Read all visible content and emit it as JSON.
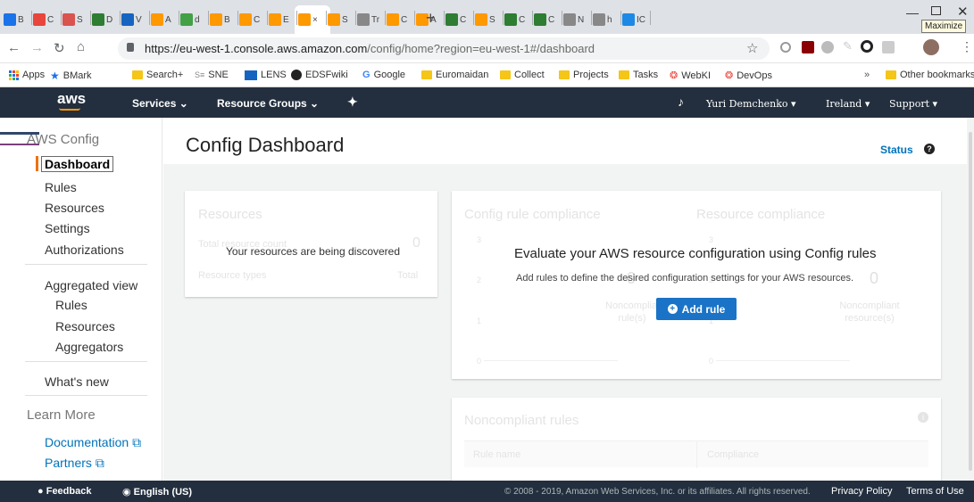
{
  "browser": {
    "tabs": [
      {
        "label": "B",
        "color": "#1a73e8"
      },
      {
        "label": "C",
        "color": "#e8453c"
      },
      {
        "label": "S",
        "color": "#d9534f"
      },
      {
        "label": "D",
        "color": "#2e7d32"
      },
      {
        "label": "V",
        "color": "#1565c0"
      },
      {
        "label": "A",
        "color": "#ff9900"
      },
      {
        "label": "d",
        "color": "#43a047"
      },
      {
        "label": "B",
        "color": "#ff9900"
      },
      {
        "label": "C",
        "color": "#ff9900"
      },
      {
        "label": "E",
        "color": "#ff9900"
      },
      {
        "label": "×",
        "color": "#ff9900"
      },
      {
        "label": "S",
        "color": "#ff9900"
      },
      {
        "label": "Tr",
        "color": "#888888"
      },
      {
        "label": "C",
        "color": "#ff9900"
      },
      {
        "label": "A",
        "color": "#ff9900"
      },
      {
        "label": "C",
        "color": "#2e7d32"
      },
      {
        "label": "S",
        "color": "#ff9900"
      },
      {
        "label": "C",
        "color": "#2e7d32"
      },
      {
        "label": "C",
        "color": "#2e7d32"
      },
      {
        "label": "N",
        "color": "#888888"
      },
      {
        "label": "h",
        "color": "#888888"
      },
      {
        "label": "IC",
        "color": "#1e88e5"
      }
    ],
    "new_tab": "+",
    "maximize_tooltip": "Maximize",
    "url_host": "https://eu-west-1.console.aws.amazon.com",
    "url_rest": "/config/home?region=eu-west-1#/dashboard",
    "bookmarks": [
      "Apps",
      "BMark",
      "Search+",
      "SNE",
      "LENS",
      "EDSFwiki",
      "Google",
      "Euromaidan",
      "Collect",
      "Projects",
      "Tasks",
      "WebKI",
      "DevOps"
    ],
    "bookmarks_overflow": "»",
    "other_bookmarks": "Other bookmarks"
  },
  "aws_nav": {
    "logo": "aws",
    "services": "Services",
    "resource_groups": "Resource Groups",
    "user": "Yuri Demchenko",
    "region": "Ireland",
    "support": "Support"
  },
  "sidebar": {
    "title": "AWS Config",
    "items": [
      "Dashboard",
      "Rules",
      "Resources",
      "Settings",
      "Authorizations"
    ],
    "aggregated_title": "Aggregated view",
    "aggregated_items": [
      "Rules",
      "Resources",
      "Aggregators"
    ],
    "whats_new": "What's new",
    "learn_more": "Learn More",
    "links": [
      "Documentation",
      "Partners"
    ]
  },
  "main": {
    "title": "Config Dashboard",
    "status": "Status",
    "resources_card": {
      "heading": "Resources",
      "total_label": "Total resource count",
      "total_value": "0",
      "types_label": "Resource types",
      "total_col": "Total",
      "discovering": "Your resources are being discovered"
    },
    "compliance_card": {
      "rule_heading": "Config rule compliance",
      "resource_heading": "Resource compliance",
      "axis_ticks": [
        "3",
        "2",
        "1",
        "0"
      ],
      "noncompliant_rules": "Noncompliant rule(s)",
      "noncompliant_resources": "Noncompliant resource(s)",
      "zero": "0",
      "overlay_title": "Evaluate your AWS resource configuration using Config rules",
      "overlay_subtitle": "Add rules to define the desired configuration settings for your AWS resources.",
      "add_rule": "Add rule"
    },
    "noncompliant_card": {
      "heading": "Noncompliant rules",
      "col_rule": "Rule name",
      "col_compliance": "Compliance"
    }
  },
  "footer": {
    "feedback": "Feedback",
    "language": "English (US)",
    "copyright": "© 2008 - 2019, Amazon Web Services, Inc. or its affiliates. All rights reserved.",
    "privacy": "Privacy Policy",
    "terms": "Terms of Use"
  }
}
